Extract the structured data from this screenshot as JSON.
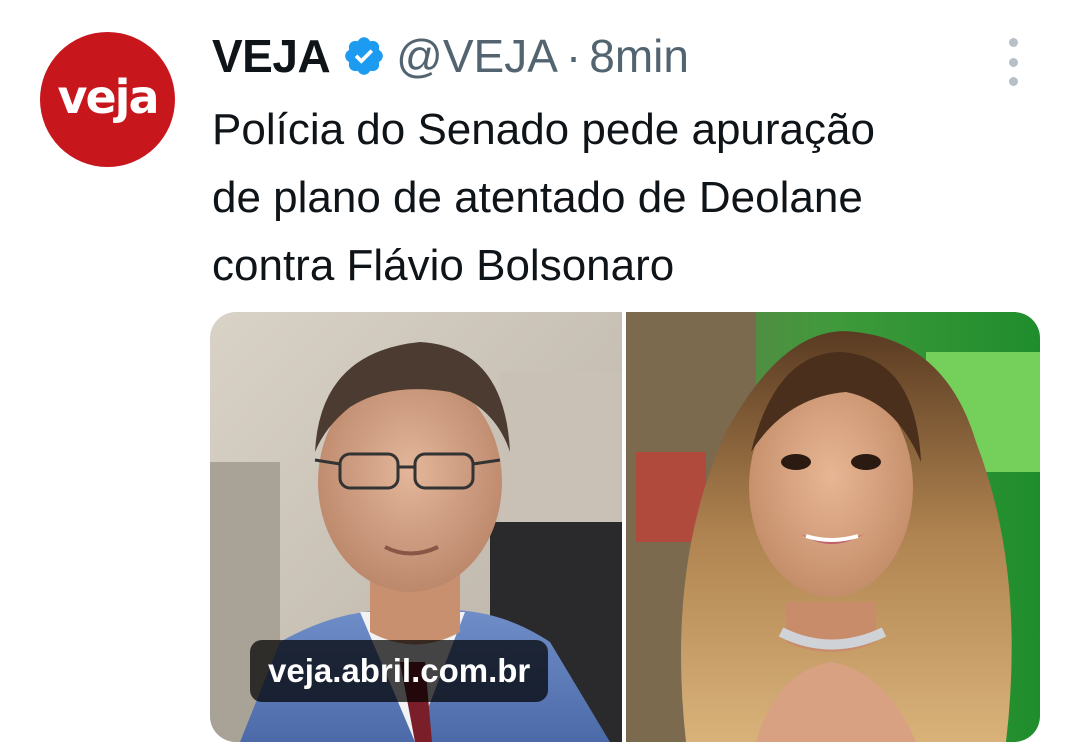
{
  "tweet": {
    "author": {
      "avatar_text": "veja",
      "display_name": "VEJA",
      "handle": "@VEJA",
      "separator": "·",
      "time": "8min",
      "verified": true
    },
    "text": "Polícia do Senado pede apuração\nde plano de atentado de Deolane\ncontra Flávio Bolsonaro",
    "media": {
      "link_domain": "veja.abril.com.br",
      "images": [
        "man-portrait-photo",
        "woman-portrait-photo"
      ]
    },
    "menu_icon": "more-options-icon"
  },
  "colors": {
    "avatar_bg": "#c8161d",
    "verified_blue": "#1d9bf0",
    "secondary_text": "#536471",
    "primary_text": "#0f1419"
  }
}
